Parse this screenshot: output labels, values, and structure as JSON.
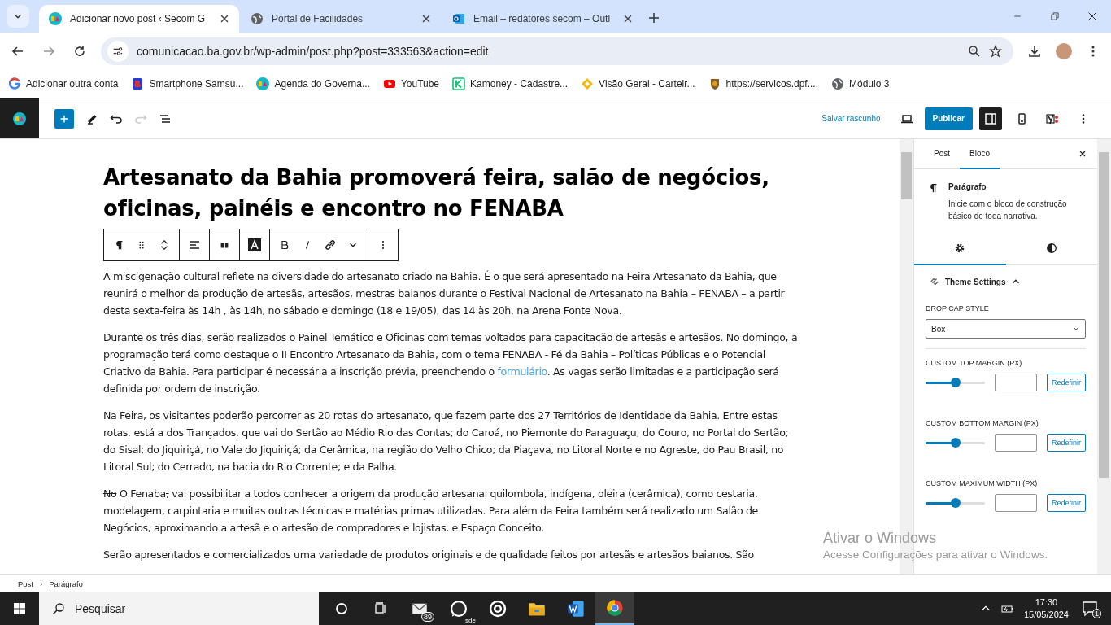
{
  "browser": {
    "tabs": [
      {
        "title": "Adicionar novo post ‹ Secom G",
        "kind": "ba",
        "selected": true
      },
      {
        "title": "Portal de Facilidades",
        "kind": "globe",
        "selected": false
      },
      {
        "title": "Email – redatores secom – Outl",
        "kind": "mail",
        "selected": false
      }
    ],
    "address": "comunicacao.ba.gov.br/wp-admin/post.php?post=333563&action=edit",
    "bookmarks": [
      {
        "label": "Adicionar outra conta",
        "kind": "g"
      },
      {
        "label": "Smartphone Samsu...",
        "kind": "b"
      },
      {
        "label": "Agenda do Governa...",
        "kind": "ba"
      },
      {
        "label": "YouTube",
        "kind": "play"
      },
      {
        "label": "Kamoney - Cadastre...",
        "kind": "k"
      },
      {
        "label": "Visão Geral - Carteir...",
        "kind": "diamond"
      },
      {
        "label": "https://servicos.dpf....",
        "kind": "shield"
      },
      {
        "label": "Módulo 3",
        "kind": "globe"
      }
    ]
  },
  "editor": {
    "toolbar": {
      "save_draft": "Salvar rascunho",
      "publish": "Publicar",
      "settings_open": true,
      "redo_disabled": true
    },
    "title": "Artesanato da Bahia promoverá feira, salão de negócios, oficinas, painéis e encontro no FENABA",
    "paragraphs": [
      [
        {
          "kind": "text",
          "text": "A miscigenação cultural reflete na diversidade do artesanato criado na Bahia. É o que será apresentado na Feira Artesanato da Bahia, que reunirá o melhor da produção de artesãs, artesãos, mestras baianos durante o Festival Nacional de Artesanato na Bahia – FENABA – a partir desta sexta-feira às 14h , às 14h, no sábado e domingo (18 e 19/05), das 14 às 20h, na Arena Fonte Nova."
        }
      ],
      [
        {
          "kind": "text",
          "text": "Durante os três dias, serão realizados o Painel Temático e Oficinas com temas voltados para capacitação de artesãs e artesãos. No domingo, a programação terá como destaque o II Encontro Artesanato da Bahia, com o tema FENABA - Fé da Bahia – Políticas Públicas e o Potencial Criativo da Bahia. Para participar é necessária a inscrição prévia, preenchendo o "
        },
        {
          "kind": "link",
          "text": "formulário"
        },
        {
          "kind": "text",
          "text": ". As vagas serão limitadas e a participação será definida por ordem de inscrição."
        }
      ],
      [
        {
          "kind": "text",
          "text": "Na Feira, os visitantes poderão percorrer as 20 rotas do artesanato, que fazem parte dos 27 Territórios de Identidade da Bahia. Entre estas rotas, está a dos Trançados, que vai do Sertão ao Médio Rio das Contas; do Caroá, no Piemonte do Paraguaçu; do Couro, no Portal do Sertão; do Sisal; do Jiquiriçá, no Vale do Jiquiriçá; da Cerâmica, na região do Velho Chico; da Piaçava, no Litoral Norte e no Agreste, do Pau Brasil, no Litoral Sul; do Cerrado, na bacia do Rio Corrente; e da Palha."
        }
      ],
      [
        {
          "kind": "strike",
          "text": "No"
        },
        {
          "kind": "text",
          "text": " O Fenaba"
        },
        {
          "kind": "strike",
          "text": ","
        },
        {
          "kind": "text",
          "text": " vai possibilitar a todos conhecer a origem da produção artesanal quilombola, indígena, oleira (cerâmica), como cestaria, modelagem, carpintaria e muitas outras técnicas e matérias primas utilizadas. Para além da Feira também será realizado um Salão de Negócios, aproximando a artesã e o artesão de compradores e lojistas, e Espaço Conceito."
        }
      ],
      [
        {
          "kind": "text",
          "text": "Serão apresentados e comercializados uma variedade de produtos originais e de qualidade feitos por artesãs e artesãos baianos. São"
        }
      ]
    ]
  },
  "sidebar": {
    "tabs": [
      {
        "label": "Post",
        "selected": false
      },
      {
        "label": "Bloco",
        "selected": true
      }
    ],
    "block": {
      "name": "Parágrafo",
      "description": "Inicie com o bloco de construção básico de toda narrativa."
    },
    "subtabs": [
      {
        "kind": "settings",
        "selected": true
      },
      {
        "kind": "styles",
        "selected": false
      }
    ],
    "panel": {
      "title": "Theme Settings",
      "expanded": true,
      "drop_cap": {
        "label": "DROP CAP STYLE",
        "value": "Box"
      },
      "sliders": [
        {
          "label": "CUSTOM TOP MARGIN (PX)",
          "level": 0.51,
          "reset": "Redefinir"
        },
        {
          "label": "CUSTOM BOTTOM MARGIN (PX)",
          "level": 0.51,
          "reset": "Redefinir"
        },
        {
          "label": "CUSTOM MAXIMUM WIDTH (PX)",
          "level": 0.51,
          "reset": "Redefinir"
        }
      ]
    }
  },
  "breadcrumb": {
    "items": [
      "Post",
      "Parágrafo"
    ],
    "separator": "›"
  },
  "windows_notice": {
    "title": "Ativar o Windows",
    "text": "Acesse Configurações para ativar o Windows."
  },
  "taskbar": {
    "search": "Pesquisar",
    "apps": [
      {
        "kind": "circle",
        "selected": false
      },
      {
        "kind": "taskview",
        "selected": false
      },
      {
        "kind": "mail",
        "badge": "89",
        "selected": false
      },
      {
        "kind": "chat",
        "label": "sde",
        "selected": false
      },
      {
        "kind": "ring",
        "selected": false
      },
      {
        "kind": "folder",
        "selected": false
      },
      {
        "kind": "word",
        "selected": false
      },
      {
        "kind": "chrome",
        "selected": true
      }
    ],
    "time": "17:30",
    "date": "15/05/2024",
    "notifications": "1"
  }
}
